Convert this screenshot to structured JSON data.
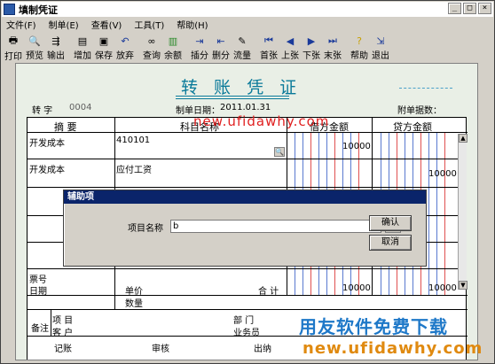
{
  "window": {
    "title": "填制凭证",
    "minimize": "_",
    "maximize": "□",
    "close": "×"
  },
  "menu": [
    "文件(F)",
    "制单(E)",
    "查看(V)",
    "工具(T)",
    "帮助(H)"
  ],
  "toolbar": [
    {
      "label": "打印",
      "icon": "printer-icon"
    },
    {
      "label": "预览",
      "icon": "preview-icon"
    },
    {
      "label": "输出",
      "icon": "export-icon"
    },
    {
      "label": "增加",
      "icon": "add-icon"
    },
    {
      "label": "保存",
      "icon": "save-icon"
    },
    {
      "label": "放弃",
      "icon": "undo-icon"
    },
    {
      "label": "查询",
      "icon": "binoculars-icon"
    },
    {
      "label": "余额",
      "icon": "balance-chart-icon"
    },
    {
      "label": "插分",
      "icon": "insert-row-icon"
    },
    {
      "label": "删分",
      "icon": "delete-row-icon"
    },
    {
      "label": "流量",
      "icon": "flow-icon"
    },
    {
      "label": "首张",
      "icon": "first-icon"
    },
    {
      "label": "上张",
      "icon": "prev-icon"
    },
    {
      "label": "下张",
      "icon": "next-icon"
    },
    {
      "label": "末张",
      "icon": "last-icon"
    },
    {
      "label": "帮助",
      "icon": "help-icon"
    },
    {
      "label": "退出",
      "icon": "exit-icon"
    }
  ],
  "voucher": {
    "title": "转 账 凭 证",
    "type_label": "转 字",
    "number": "0004",
    "date_label": "制单日期：",
    "date": "2011.01.31",
    "attach_label": "附单据数：",
    "headers": {
      "summary": "摘 要",
      "account": "科目名称",
      "debit": "借方金额",
      "credit": "贷方金额"
    },
    "rows": [
      {
        "summary": "开发成本",
        "account": "410101",
        "debit": "10000",
        "credit": ""
      },
      {
        "summary": "开发成本",
        "account": "应付工资",
        "debit": "",
        "credit": "10000"
      }
    ],
    "footer": {
      "bill_no": "票号",
      "date": "日期",
      "unit_price": "单价",
      "quantity": "数量",
      "total": "合 计",
      "total_debit": "10000",
      "total_credit": "10000",
      "remark": "备注",
      "project": "项 目",
      "customer": "客 户",
      "dept": "部 门",
      "salesman": "业务员"
    },
    "sign": {
      "bookkeep": "记账",
      "audit": "审核",
      "cashier": "出纳"
    }
  },
  "watermark_url": "new.ufidawhy.com",
  "dialog": {
    "title": "辅助项",
    "field_label": "项目名称",
    "field_value": "b",
    "ok": "确认",
    "cancel": "取消"
  },
  "brand": {
    "text": "用友软件免费下载",
    "url": "new.ufidawhy.com"
  }
}
